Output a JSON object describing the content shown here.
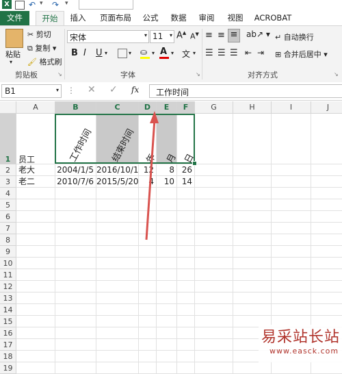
{
  "ribbon_tabs": [
    "文件",
    "开始",
    "插入",
    "页面布局",
    "公式",
    "数据",
    "审阅",
    "视图",
    "ACROBAT"
  ],
  "clipboard": {
    "paste": "粘贴",
    "cut": "剪切",
    "copy": "复制",
    "format_painter": "格式刷",
    "group": "剪贴板"
  },
  "font": {
    "name": "宋体",
    "size": "11",
    "group": "字体"
  },
  "alignment": {
    "wrap": "自动换行",
    "merge": "合并后居中",
    "group": "对齐方式"
  },
  "formula_bar": {
    "name_box": "B1",
    "fx": "fx",
    "content": "工作时间"
  },
  "columns": [
    "A",
    "B",
    "C",
    "D",
    "E",
    "F",
    "G",
    "H",
    "I",
    "J"
  ],
  "rows": [
    "1",
    "2",
    "3",
    "4",
    "5",
    "6",
    "7",
    "8",
    "9",
    "10",
    "11",
    "12",
    "13",
    "14",
    "15",
    "16",
    "17",
    "18",
    "19"
  ],
  "sheet": {
    "headers": {
      "A1": "员工",
      "B1": "工作时间",
      "C1": "结束时间",
      "D1": "年",
      "E1": "月",
      "F1": "日"
    },
    "row2": {
      "A": "老大",
      "B": "2004/1/5",
      "C": "2016/10/1",
      "D": "12",
      "E": "8",
      "F": "26"
    },
    "row3": {
      "A": "老二",
      "B": "2010/7/6",
      "C": "2015/5/20",
      "D": "4",
      "E": "10",
      "F": "14"
    }
  },
  "watermark": {
    "title": "易采站长站",
    "url": "www.easck.com"
  },
  "colors": {
    "excel_green": "#217346",
    "arrow_red": "#d9534f",
    "highlight_gray": "#c9c9c9"
  }
}
